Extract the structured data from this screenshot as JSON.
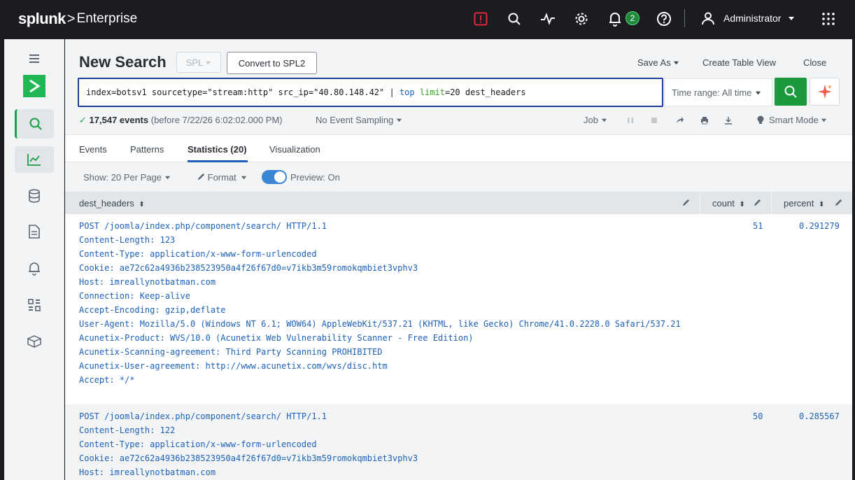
{
  "topbar": {
    "brand": "splunk",
    "brand_sep": ">",
    "product": "Enterprise",
    "notifications_count": "2",
    "user": "Administrator",
    "accent_alert": "#e0293b"
  },
  "nav": {
    "items": [
      "menu-icon",
      "search-icon",
      "chart-icon",
      "database-icon",
      "document-icon",
      "bell-icon",
      "grid-icon",
      "cube-icon"
    ]
  },
  "page": {
    "title": "New Search",
    "spl_label": "SPL",
    "convert_label": "Convert to SPL2",
    "save_as": "Save As",
    "create_table": "Create Table View",
    "close": "Close"
  },
  "search": {
    "q_base": "index=botsv1 sourcetype=\"stream:http\" src_ip=\"40.80.148.42\" | ",
    "q_top": "top",
    "q_sp": " ",
    "q_limit": "limit",
    "q_rest": "=20 dest_headers",
    "time_range": "Time range: All time"
  },
  "status": {
    "events": "17,547 events",
    "before": "(before 7/22/26 6:02:02.000 PM)",
    "sampling": "No Event Sampling",
    "job": "Job",
    "mode": "Smart Mode"
  },
  "tabs": {
    "events": "Events",
    "patterns": "Patterns",
    "statistics": "Statistics (20)",
    "visualization": "Visualization"
  },
  "options": {
    "show": "Show: 20 Per Page",
    "format": "Format",
    "preview": "Preview: On"
  },
  "table": {
    "col_headers": "dest_headers",
    "col_count": "count",
    "col_percent": "percent",
    "rows": [
      {
        "lines": [
          "POST /joomla/index.php/component/search/ HTTP/1.1",
          "Content-Length: 123",
          "Content-Type: application/x-www-form-urlencoded",
          "Cookie: ae72c62a4936b238523950a4f26f67d0=v7ikb3m59romokqmbiet3vphv3",
          "Host: imreallynotbatman.com",
          "Connection: Keep-alive",
          "Accept-Encoding: gzip,deflate",
          "User-Agent: Mozilla/5.0 (Windows NT 6.1; WOW64) AppleWebKit/537.21 (KHTML, like Gecko) Chrome/41.0.2228.0 Safari/537.21",
          "Acunetix-Product: WVS/10.0 (Acunetix Web Vulnerability Scanner - Free Edition)",
          "Acunetix-Scanning-agreement: Third Party Scanning PROHIBITED",
          "Acunetix-User-agreement: http://www.acunetix.com/wvs/disc.htm",
          "Accept: */*"
        ],
        "count": "51",
        "percent": "0.291279"
      },
      {
        "lines": [
          "POST /joomla/index.php/component/search/ HTTP/1.1",
          "Content-Length: 122",
          "Content-Type: application/x-www-form-urlencoded",
          "Cookie: ae72c62a4936b238523950a4f26f67d0=v7ikb3m59romokqmbiet3vphv3",
          "Host: imreallynotbatman.com"
        ],
        "count": "50",
        "percent": "0.285567"
      }
    ]
  }
}
